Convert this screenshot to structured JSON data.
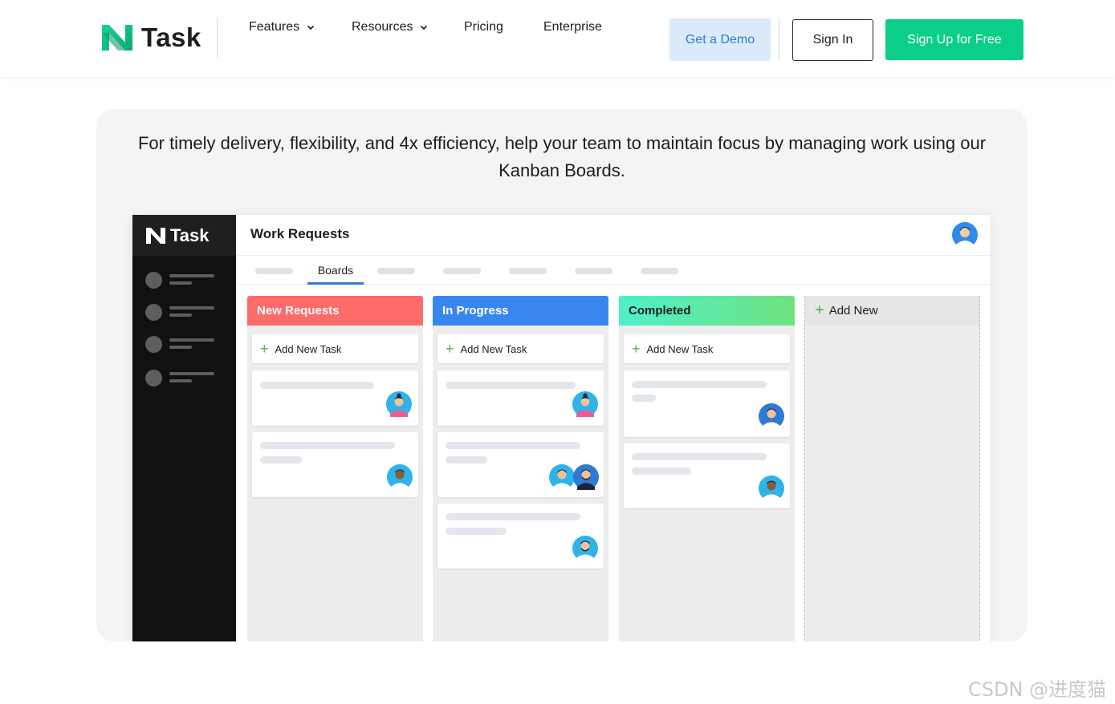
{
  "nav": {
    "brand": "Task",
    "links": [
      "Features",
      "Resources",
      "Pricing",
      "Enterprise"
    ],
    "demo_label": "Get a Demo",
    "signin_label": "Sign In",
    "signup_label": "Sign Up for Free"
  },
  "hero": {
    "text": "For timely delivery, flexibility, and 4x efficiency, help your team to maintain focus by managing work using our Kanban Boards."
  },
  "app": {
    "brand": "Task",
    "title": "Work Requests",
    "active_tab": "Boards",
    "columns": [
      {
        "title": "New Requests",
        "add_label": "Add New Task"
      },
      {
        "title": "In Progress",
        "add_label": "Add New Task"
      },
      {
        "title": "Completed",
        "add_label": "Add New Task"
      },
      {
        "title": "Add New"
      }
    ]
  },
  "watermark": "CSDN @进度猫",
  "colors": {
    "accent": "#0bcf87",
    "demo_bg": "#dbeaf9",
    "new_requests": "#fe6b6b",
    "in_progress": "#3a86f0",
    "completed": "#4ef0c9"
  }
}
